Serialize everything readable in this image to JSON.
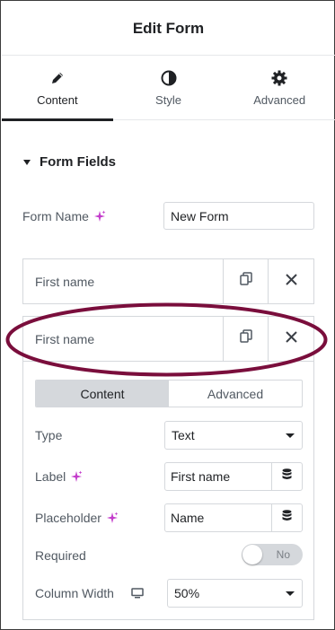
{
  "header": {
    "title": "Edit Form"
  },
  "tabs": [
    {
      "label": "Content",
      "icon": "pencil-icon",
      "active": true
    },
    {
      "label": "Style",
      "icon": "contrast-icon",
      "active": false
    },
    {
      "label": "Advanced",
      "icon": "gear-icon",
      "active": false
    }
  ],
  "section": {
    "title": "Form Fields"
  },
  "form_name": {
    "label": "Form Name",
    "value": "New Form"
  },
  "repeater": {
    "items": [
      {
        "title": "First name"
      },
      {
        "title": "First name"
      }
    ]
  },
  "field_panel": {
    "switcher": {
      "content": "Content",
      "advanced": "Advanced"
    },
    "type": {
      "label": "Type",
      "value": "Text"
    },
    "label": {
      "label": "Label",
      "value": "First name"
    },
    "placeholder": {
      "label": "Placeholder",
      "value": "Name"
    },
    "required": {
      "label": "Required",
      "state": "No"
    },
    "column_width": {
      "label": "Column Width",
      "value": "50%"
    }
  },
  "colors": {
    "accent_ai": "#c33ccb",
    "annotation": "#7a0e3c",
    "text_primary": "#1f2124",
    "text_secondary": "#515962",
    "border": "#d5d8dc"
  }
}
